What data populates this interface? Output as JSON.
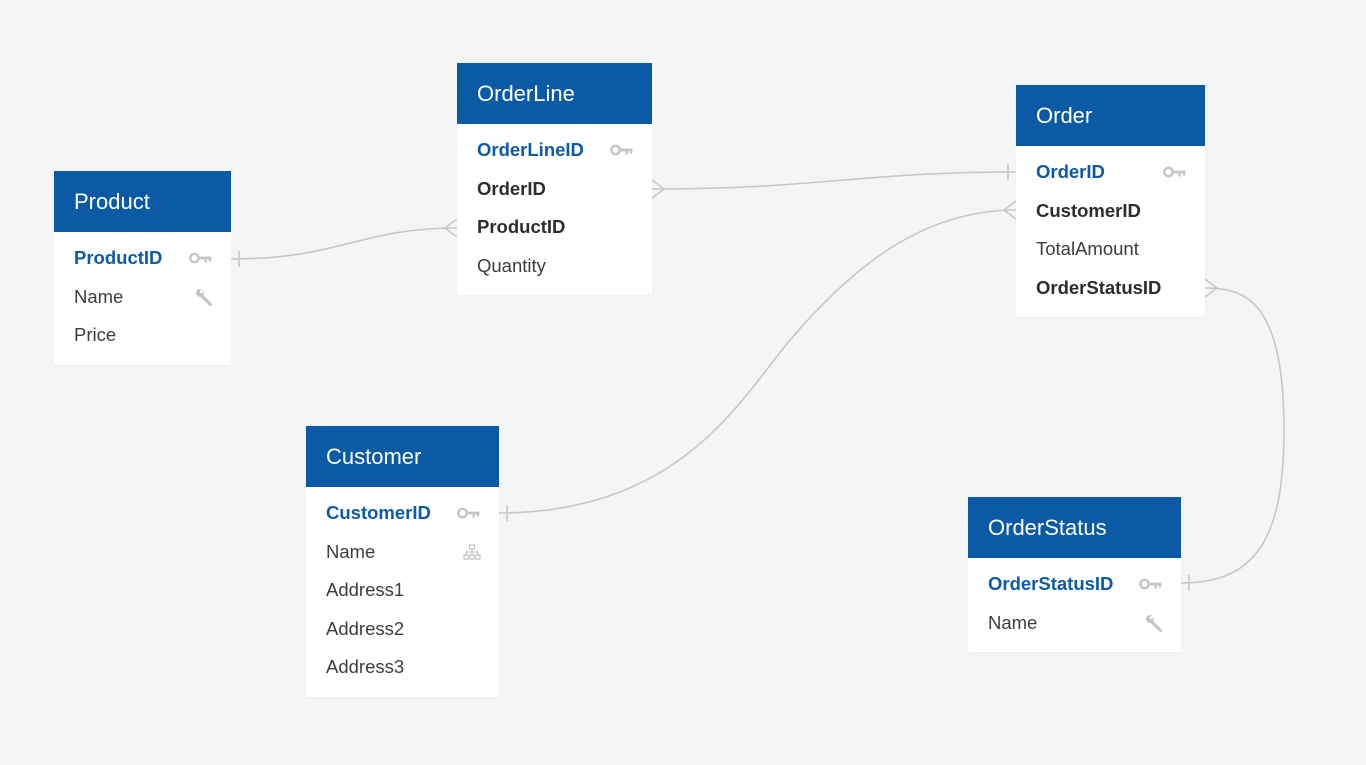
{
  "colors": {
    "background": "#f4f5f5",
    "header": "#0a5aa6",
    "primary_key_text": "#0d5aa7",
    "connector": "#c5c8ca",
    "icon": "#c3c6c9"
  },
  "entities": {
    "product": {
      "title": "Product",
      "fields": [
        {
          "name": "ProductID",
          "kind": "pk",
          "icon": "key-icon"
        },
        {
          "name": "Name",
          "kind": "plain",
          "icon": "wrench-icon"
        },
        {
          "name": "Price",
          "kind": "plain",
          "icon": ""
        }
      ]
    },
    "orderline": {
      "title": "OrderLine",
      "fields": [
        {
          "name": "OrderLineID",
          "kind": "pk",
          "icon": "key-icon"
        },
        {
          "name": "OrderID",
          "kind": "fk",
          "icon": ""
        },
        {
          "name": "ProductID",
          "kind": "fk",
          "icon": ""
        },
        {
          "name": "Quantity",
          "kind": "plain",
          "icon": ""
        }
      ]
    },
    "order": {
      "title": "Order",
      "fields": [
        {
          "name": "OrderID",
          "kind": "pk",
          "icon": "key-icon"
        },
        {
          "name": "CustomerID",
          "kind": "fk",
          "icon": ""
        },
        {
          "name": "TotalAmount",
          "kind": "plain",
          "icon": ""
        },
        {
          "name": "OrderStatusID",
          "kind": "fk",
          "icon": ""
        }
      ]
    },
    "customer": {
      "title": "Customer",
      "fields": [
        {
          "name": "CustomerID",
          "kind": "pk",
          "icon": "key-icon"
        },
        {
          "name": "Name",
          "kind": "plain",
          "icon": "hierarchy-icon"
        },
        {
          "name": "Address1",
          "kind": "plain",
          "icon": ""
        },
        {
          "name": "Address2",
          "kind": "plain",
          "icon": ""
        },
        {
          "name": "Address3",
          "kind": "plain",
          "icon": ""
        }
      ]
    },
    "orderstatus": {
      "title": "OrderStatus",
      "fields": [
        {
          "name": "OrderStatusID",
          "kind": "pk",
          "icon": "key-icon"
        },
        {
          "name": "Name",
          "kind": "plain",
          "icon": "wrench-icon"
        }
      ]
    }
  },
  "relationships": [
    {
      "from": "Product.ProductID",
      "to": "OrderLine.ProductID",
      "from_cardinality": "one",
      "to_cardinality": "many"
    },
    {
      "from": "Order.OrderID",
      "to": "OrderLine.OrderID",
      "from_cardinality": "one",
      "to_cardinality": "many"
    },
    {
      "from": "Customer.CustomerID",
      "to": "Order.CustomerID",
      "from_cardinality": "one",
      "to_cardinality": "many"
    },
    {
      "from": "OrderStatus.OrderStatusID",
      "to": "Order.OrderStatusID",
      "from_cardinality": "one",
      "to_cardinality": "many"
    }
  ]
}
